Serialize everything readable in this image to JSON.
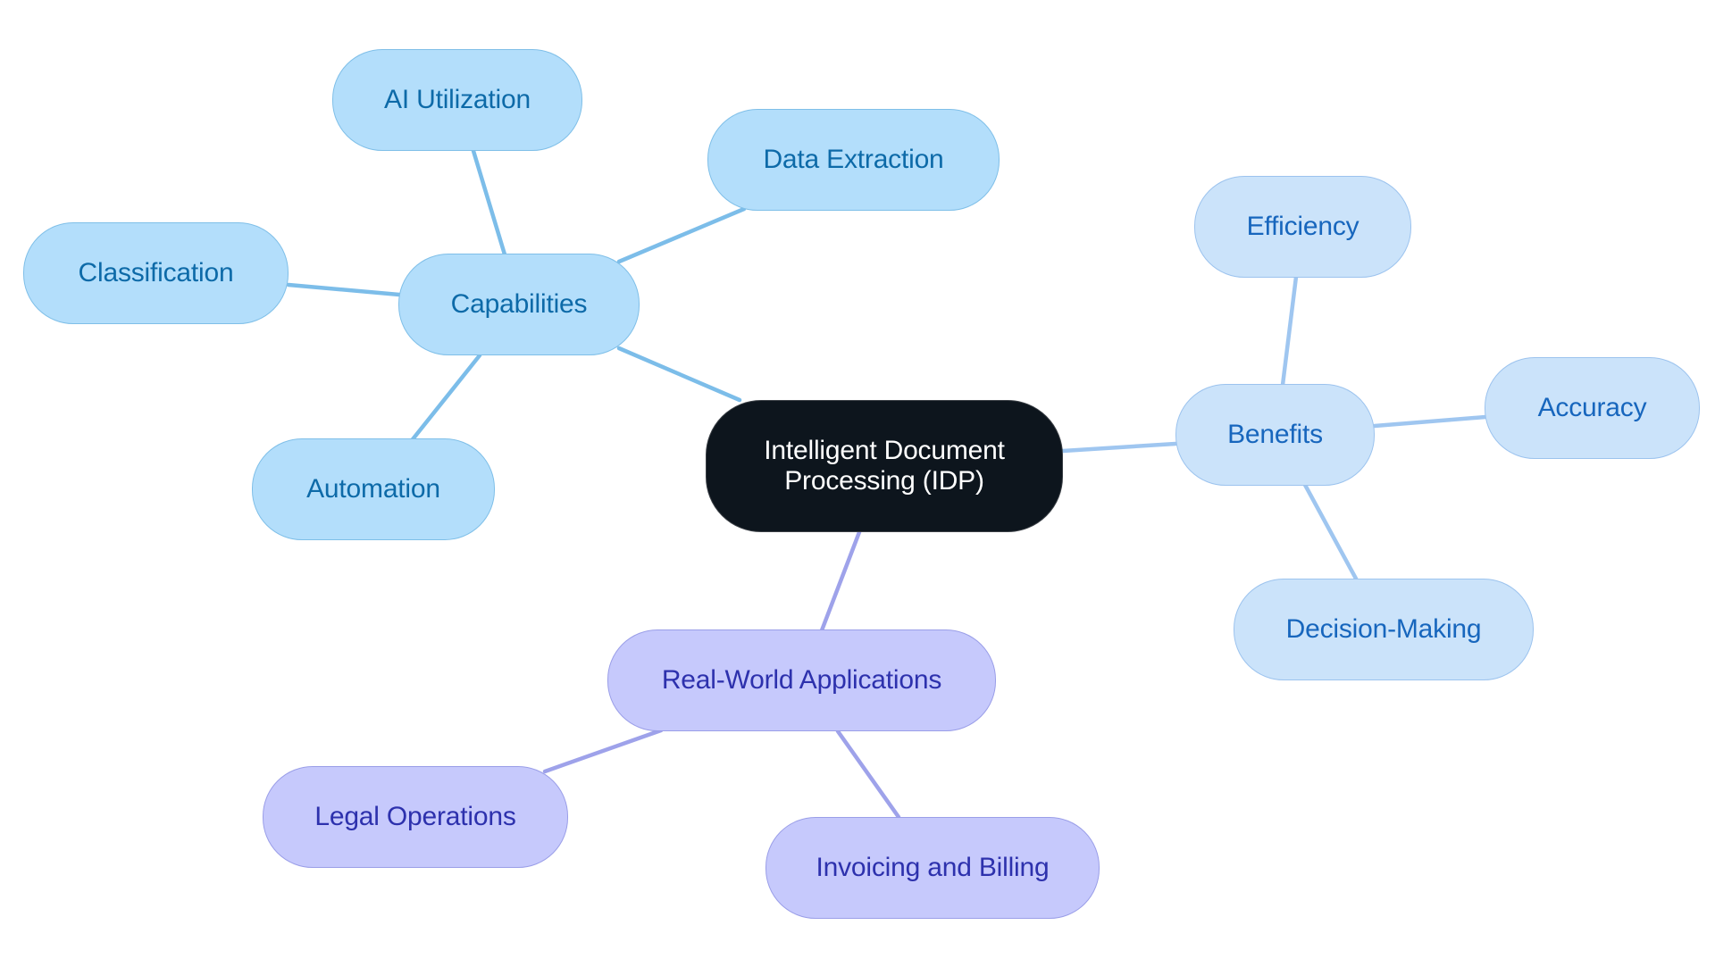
{
  "diagram": {
    "type": "mind-map",
    "root": {
      "id": "root",
      "label": "Intelligent Document\nProcessing (IDP)"
    },
    "branches": [
      {
        "id": "capabilities",
        "label": "Capabilities",
        "theme": "cap",
        "edge_color": "#7cbde9",
        "children": [
          {
            "id": "ai-utilization",
            "label": "AI Utilization"
          },
          {
            "id": "data-extraction",
            "label": "Data Extraction"
          },
          {
            "id": "classification",
            "label": "Classification"
          },
          {
            "id": "automation",
            "label": "Automation"
          }
        ]
      },
      {
        "id": "benefits",
        "label": "Benefits",
        "theme": "ben",
        "edge_color": "#9fc6f0",
        "children": [
          {
            "id": "efficiency",
            "label": "Efficiency"
          },
          {
            "id": "accuracy",
            "label": "Accuracy"
          },
          {
            "id": "decision-making",
            "label": "Decision-Making"
          }
        ]
      },
      {
        "id": "real-world-applications",
        "label": "Real-World Applications",
        "theme": "app",
        "edge_color": "#9ea2ea",
        "children": [
          {
            "id": "legal-operations",
            "label": "Legal Operations"
          },
          {
            "id": "invoicing-and-billing",
            "label": "Invoicing and Billing"
          }
        ]
      }
    ],
    "colors": {
      "root_fill": "#0d151d",
      "capabilities_fill": "#b3defb",
      "benefits_fill": "#cbe3fa",
      "applications_fill": "#c6c9fc"
    }
  }
}
